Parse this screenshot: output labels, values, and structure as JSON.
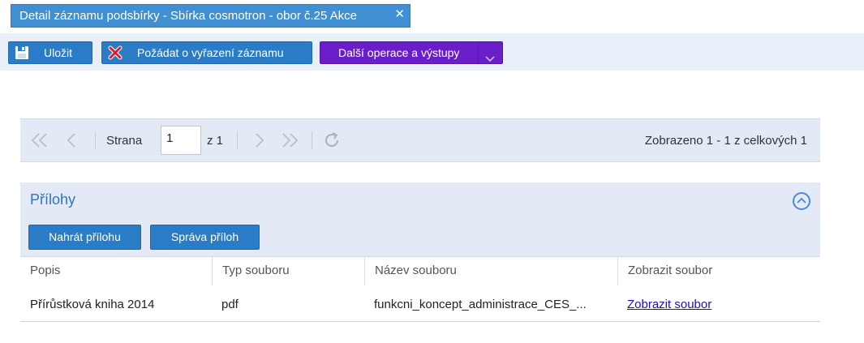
{
  "tab": {
    "title": "Detail záznamu podsbírky - Sbírka cosmotron - obor č.25 Akce",
    "close_glyph": "✕"
  },
  "toolbar": {
    "save_label": "Uložit",
    "request_removal_label": "Požádat o vyřazení záznamu",
    "more_label": "Další operace a výstupy"
  },
  "pager": {
    "page_label": "Strana",
    "page_value": "1",
    "of_label": "z 1",
    "info": "Zobrazeno 1 - 1 z celkových 1"
  },
  "attachments": {
    "title": "Přílohy",
    "upload_label": "Nahrát přílohu",
    "manage_label": "Správa příloh"
  },
  "grid": {
    "columns": [
      "Popis",
      "Typ souboru",
      "Název souboru",
      "Zobrazit soubor"
    ],
    "rows": [
      {
        "description": "Přírůstková kniha 2014",
        "type": "pdf",
        "filename": "funkcni_koncept_administrace_CES_...",
        "link": "Zobrazit soubor"
      }
    ]
  },
  "colors": {
    "accent_blue": "#2a7cc7",
    "accent_purple": "#6a1ec9",
    "panel_bg": "#e3eaf5",
    "title_blue": "#2d76c0"
  },
  "icons": [
    "close-icon",
    "save-disk-icon",
    "red-x-icon",
    "dropdown-chevron-icon",
    "first-page-icon",
    "prev-page-icon",
    "next-page-icon",
    "last-page-icon",
    "refresh-icon",
    "collapse-icon"
  ]
}
